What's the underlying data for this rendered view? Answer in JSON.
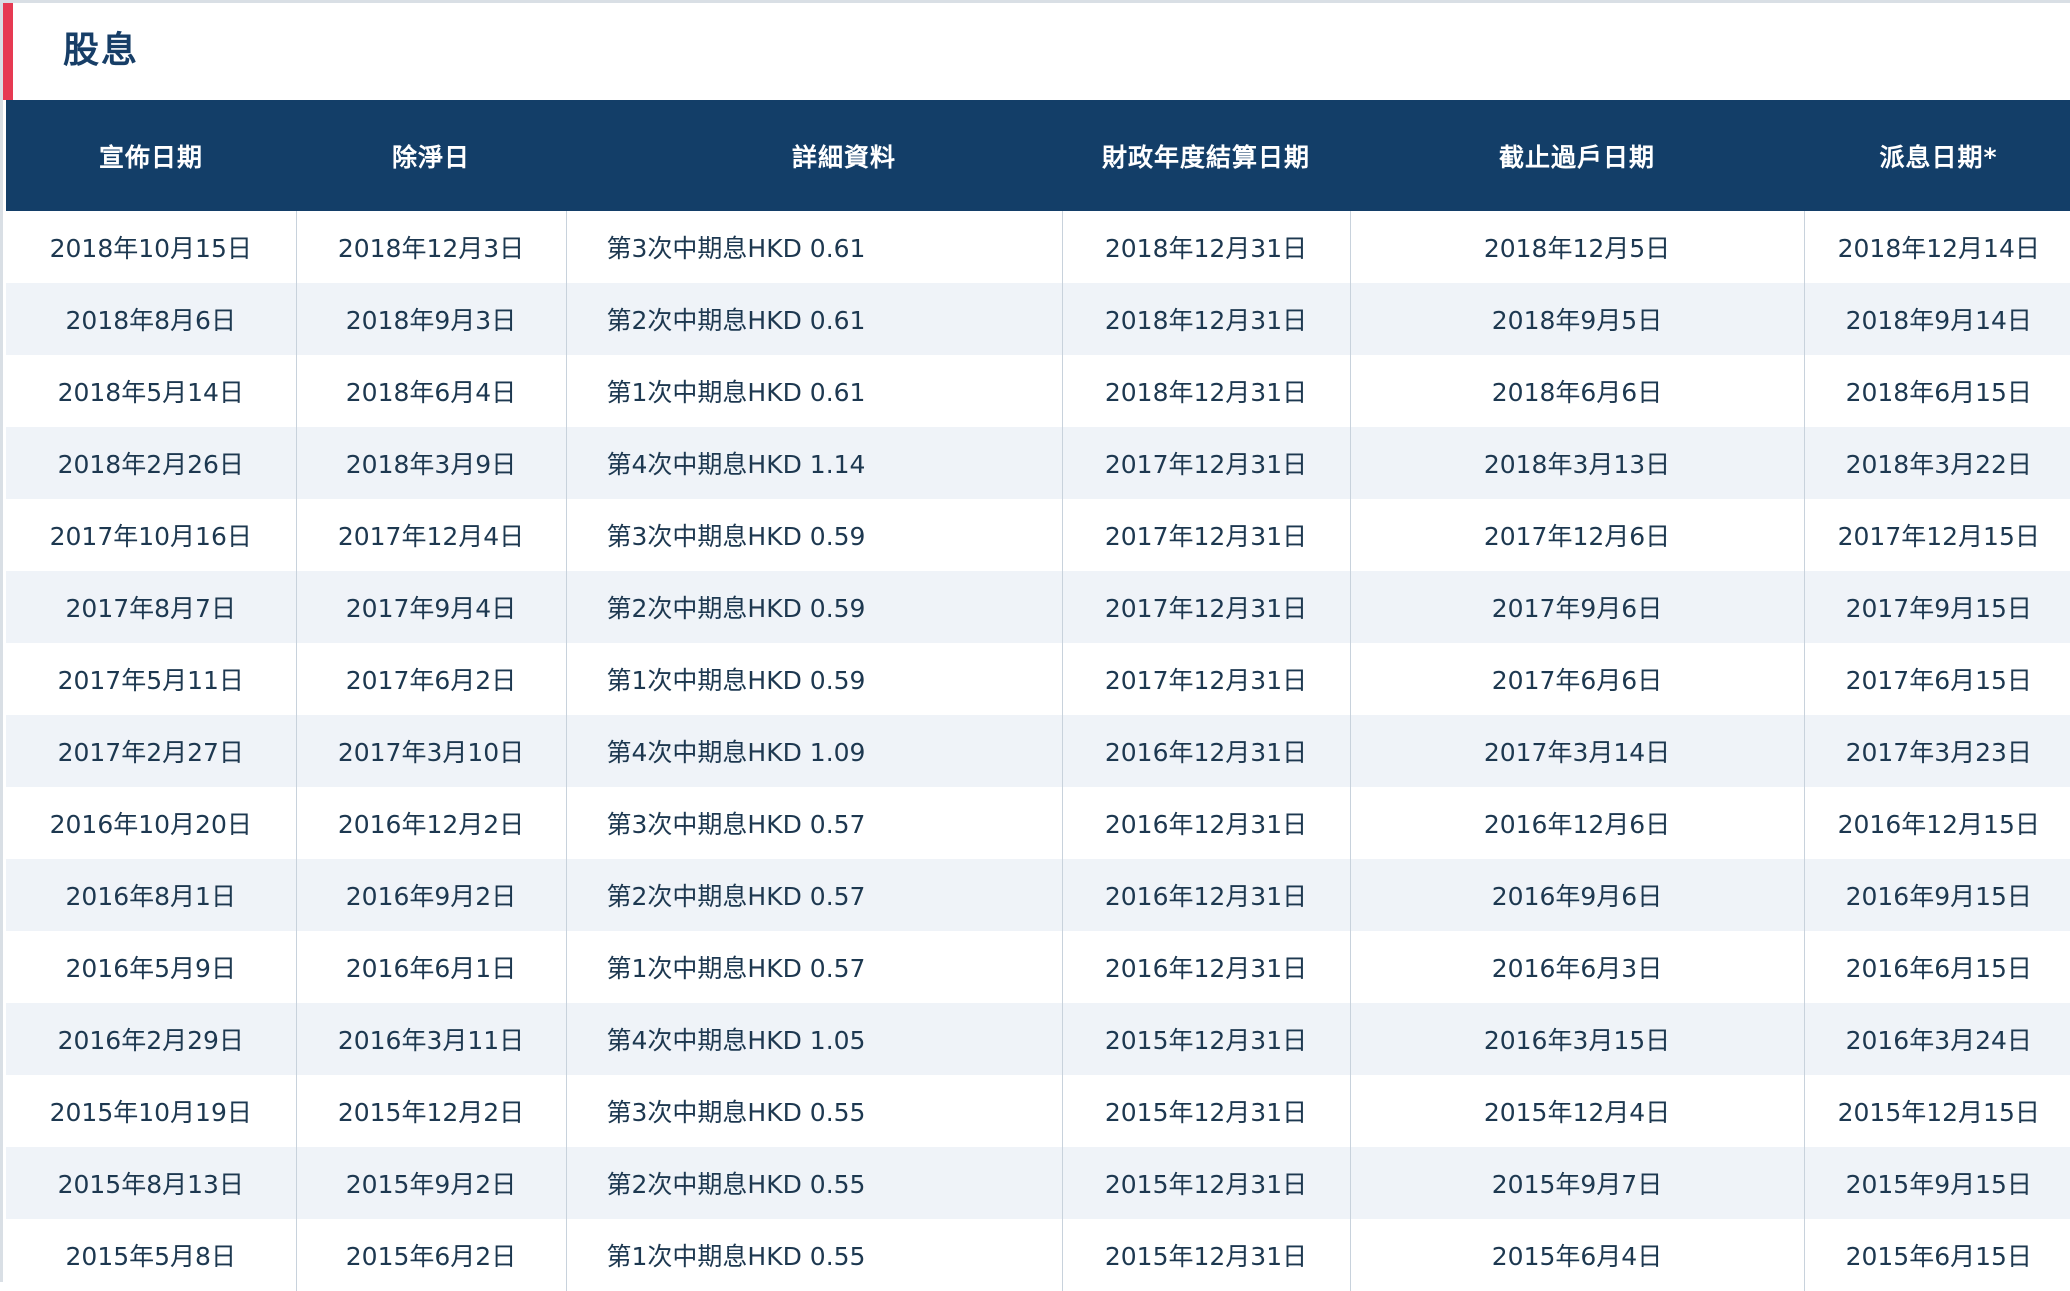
{
  "section": {
    "title": "股息"
  },
  "table": {
    "columns": [
      "宣佈日期",
      "除淨日",
      "詳細資料",
      "財政年度結算日期",
      "截止過戶日期",
      "派息日期*"
    ],
    "rows": [
      [
        "2018年10月15日",
        "2018年12月3日",
        "第3次中期息HKD 0.61",
        "2018年12月31日",
        "2018年12月5日",
        "2018年12月14日"
      ],
      [
        "2018年8月6日",
        "2018年9月3日",
        "第2次中期息HKD 0.61",
        "2018年12月31日",
        "2018年9月5日",
        "2018年9月14日"
      ],
      [
        "2018年5月14日",
        "2018年6月4日",
        "第1次中期息HKD 0.61",
        "2018年12月31日",
        "2018年6月6日",
        "2018年6月15日"
      ],
      [
        "2018年2月26日",
        "2018年3月9日",
        "第4次中期息HKD 1.14",
        "2017年12月31日",
        "2018年3月13日",
        "2018年3月22日"
      ],
      [
        "2017年10月16日",
        "2017年12月4日",
        "第3次中期息HKD 0.59",
        "2017年12月31日",
        "2017年12月6日",
        "2017年12月15日"
      ],
      [
        "2017年8月7日",
        "2017年9月4日",
        "第2次中期息HKD 0.59",
        "2017年12月31日",
        "2017年9月6日",
        "2017年9月15日"
      ],
      [
        "2017年5月11日",
        "2017年6月2日",
        "第1次中期息HKD 0.59",
        "2017年12月31日",
        "2017年6月6日",
        "2017年6月15日"
      ],
      [
        "2017年2月27日",
        "2017年3月10日",
        "第4次中期息HKD 1.09",
        "2016年12月31日",
        "2017年3月14日",
        "2017年3月23日"
      ],
      [
        "2016年10月20日",
        "2016年12月2日",
        "第3次中期息HKD 0.57",
        "2016年12月31日",
        "2016年12月6日",
        "2016年12月15日"
      ],
      [
        "2016年8月1日",
        "2016年9月2日",
        "第2次中期息HKD 0.57",
        "2016年12月31日",
        "2016年9月6日",
        "2016年9月15日"
      ],
      [
        "2016年5月9日",
        "2016年6月1日",
        "第1次中期息HKD 0.57",
        "2016年12月31日",
        "2016年6月3日",
        "2016年6月15日"
      ],
      [
        "2016年2月29日",
        "2016年3月11日",
        "第4次中期息HKD 1.05",
        "2015年12月31日",
        "2016年3月15日",
        "2016年3月24日"
      ],
      [
        "2015年10月19日",
        "2015年12月2日",
        "第3次中期息HKD 0.55",
        "2015年12月31日",
        "2015年12月4日",
        "2015年12月15日"
      ],
      [
        "2015年8月13日",
        "2015年9月2日",
        "第2次中期息HKD 0.55",
        "2015年12月31日",
        "2015年9月7日",
        "2015年9月15日"
      ],
      [
        "2015年5月8日",
        "2015年6月2日",
        "第1次中期息HKD 0.55",
        "2015年12月31日",
        "2015年6月4日",
        "2015年6月15日"
      ]
    ]
  },
  "colors": {
    "accent": "#e63a52",
    "header_bg": "#133e68",
    "title_text": "#173e67",
    "row_alt": "#eff3f8"
  }
}
